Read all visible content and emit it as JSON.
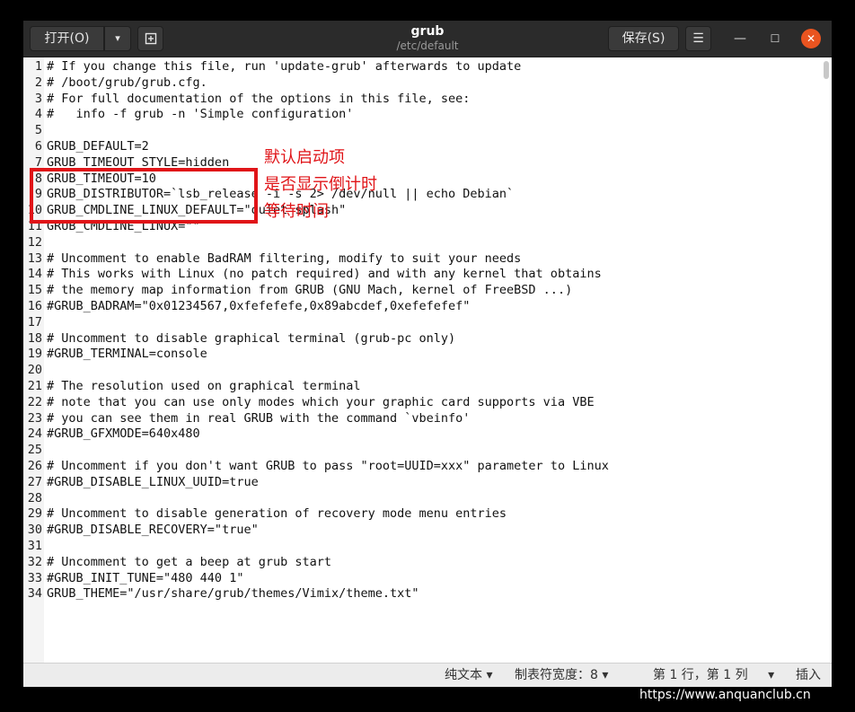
{
  "header": {
    "open_label": "打开(O)",
    "open_arrow": "▾",
    "newtab_icon": "new-tab-icon",
    "title": "grub",
    "subtitle": "/etc/default",
    "save_label": "保存(S)",
    "menu_icon": "☰",
    "min_icon": "—",
    "max_icon": "☐",
    "close_icon": "✕"
  },
  "editor": {
    "lines": [
      "# If you change this file, run 'update-grub' afterwards to update",
      "# /boot/grub/grub.cfg.",
      "# For full documentation of the options in this file, see:",
      "#   info -f grub -n 'Simple configuration'",
      "",
      "GRUB_DEFAULT=2",
      "GRUB_TIMEOUT_STYLE=hidden",
      "GRUB_TIMEOUT=10",
      "GRUB_DISTRIBUTOR=`lsb_release -i -s 2> /dev/null || echo Debian`",
      "GRUB_CMDLINE_LINUX_DEFAULT=\"quiet splash\"",
      "GRUB_CMDLINE_LINUX=\"\"",
      "",
      "# Uncomment to enable BadRAM filtering, modify to suit your needs",
      "# This works with Linux (no patch required) and with any kernel that obtains",
      "# the memory map information from GRUB (GNU Mach, kernel of FreeBSD ...)",
      "#GRUB_BADRAM=\"0x01234567,0xfefefefe,0x89abcdef,0xefefefef\"",
      "",
      "# Uncomment to disable graphical terminal (grub-pc only)",
      "#GRUB_TERMINAL=console",
      "",
      "# The resolution used on graphical terminal",
      "# note that you can use only modes which your graphic card supports via VBE",
      "# you can see them in real GRUB with the command `vbeinfo'",
      "#GRUB_GFXMODE=640x480",
      "",
      "# Uncomment if you don't want GRUB to pass \"root=UUID=xxx\" parameter to Linux",
      "#GRUB_DISABLE_LINUX_UUID=true",
      "",
      "# Uncomment to disable generation of recovery mode menu entries",
      "#GRUB_DISABLE_RECOVERY=\"true\"",
      "",
      "# Uncomment to get a beep at grub start",
      "#GRUB_INIT_TUNE=\"480 440 1\"",
      "GRUB_THEME=\"/usr/share/grub/themes/Vimix/theme.txt\""
    ]
  },
  "annotation": {
    "note1": "默认启动项",
    "note2": "是否显示倒计时",
    "note3": "等待时间",
    "color": "#e01418"
  },
  "statusbar": {
    "syntax": "纯文本",
    "tab_width": "制表符宽度：8",
    "position": "第 1 行，第 1 列",
    "mode": "插入",
    "arrow": "▾"
  },
  "watermark": "https://www.anquanclub.cn"
}
